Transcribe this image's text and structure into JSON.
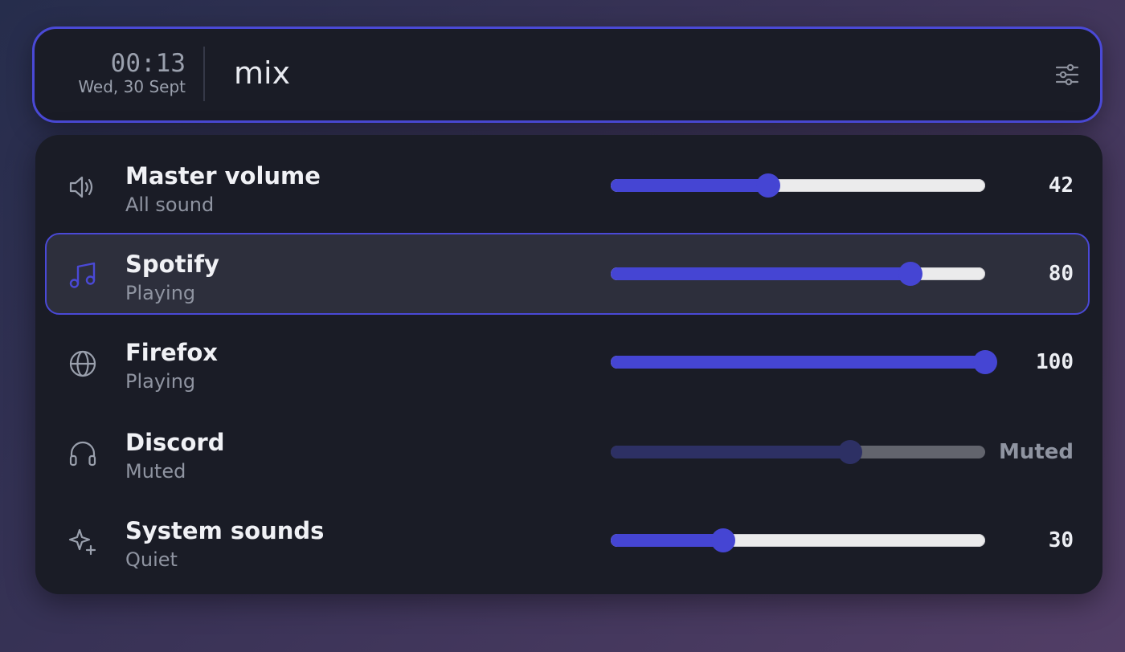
{
  "header": {
    "time": "00:13",
    "date": "Wed, 30 Sept",
    "query": "mix",
    "settings_icon": "sliders-icon"
  },
  "colors": {
    "accent": "#4545d3",
    "panel_bg": "#1a1c26",
    "selected_bg": "#2d2f3c"
  },
  "channels": [
    {
      "title": "Master volume",
      "subtitle": "All sound",
      "icon": "speaker-icon",
      "level": 0.42,
      "value": "42",
      "muted": false,
      "selected": false
    },
    {
      "title": "Spotify",
      "subtitle": "Playing",
      "icon": "music-note-icon",
      "level": 0.8,
      "value": "80",
      "muted": false,
      "selected": true
    },
    {
      "title": "Firefox",
      "subtitle": "Playing",
      "icon": "globe-icon",
      "level": 1.0,
      "value": "100",
      "muted": false,
      "selected": false
    },
    {
      "title": "Discord",
      "subtitle": "Muted",
      "icon": "headphones-icon",
      "level": 0.64,
      "value": "Muted",
      "muted": true,
      "selected": false
    },
    {
      "title": "System sounds",
      "subtitle": "Quiet",
      "icon": "sparkle-icon",
      "level": 0.3,
      "value": "30",
      "muted": false,
      "selected": false
    }
  ]
}
